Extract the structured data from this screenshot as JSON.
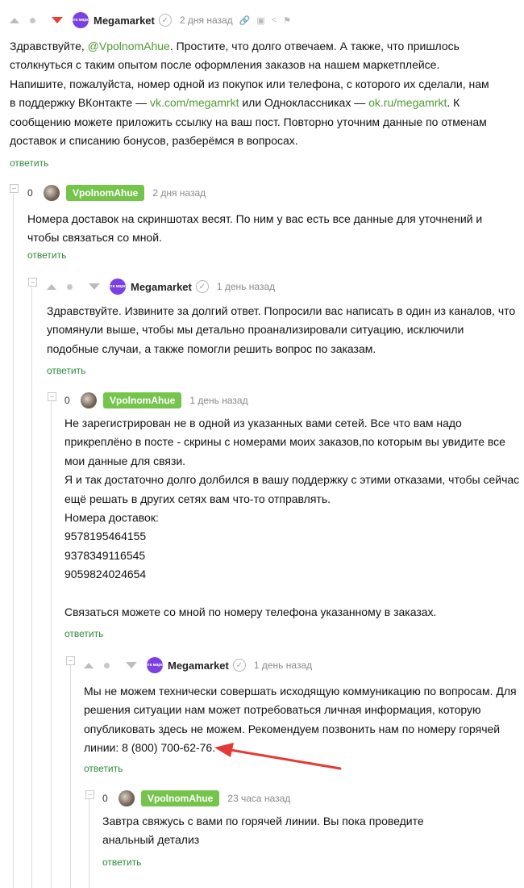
{
  "c1": {
    "author": "Megamarket",
    "avatar_text": "мега маркет",
    "time": "2 дня назад",
    "text_a": "Здравствуйте, ",
    "mention": "@VpolnomAhue",
    "text_b": ". Простите, что долго отвечаем. А также, что пришлось столкнуться с таким опытом после оформления заказов на нашем маркетплейсе. Напишите, пожалуйста, номер одной из покупок или телефона, с которого их сделали, нам в поддержку ВКонтакте — ",
    "link_vk": "vk.com/megamrkt",
    "text_c": " или Одноклассниках — ",
    "link_ok": "ok.ru/megamrkt",
    "text_d": ". К сообщению можете приложить ссылку на ваш пост. Повторно уточним данные по отменам доставок и списанию бонусов, разберёмся в вопросах.",
    "reply": "ответить"
  },
  "c2": {
    "score": "0",
    "author": "VpolnomAhue",
    "time": "2 дня назад",
    "text": "Номера доставок на скриншотах весят. По ним у вас есть все данные для уточнений и чтобы связаться со мной.",
    "reply": "ответить"
  },
  "c3": {
    "author": "Megamarket",
    "avatar_text": "мега маркет",
    "time": "1 день назад",
    "text": "Здравствуйте. Извините за долгий ответ. Попросили вас написать в один из каналов, что упомянули выше, чтобы мы детально проанализировали ситуацию, исключили подобные случаи, а также помогли решить вопрос по заказам.",
    "reply": "ответить"
  },
  "c4": {
    "score": "0",
    "author": "VpolnomAhue",
    "time": "1 день назад",
    "p1": "Не зарегистрирован не в одной из указанных вами сетей. Все что вам надо прикреплёно в посте - скрины с номерами моих заказов,по которым вы увидите все мои данные для связи.",
    "p2": "Я и так достаточно долго долбился в вашу поддержку с этими отказами, чтобы сейчас ещё решать в других сетях вам что-то отправлять.",
    "p3": "Номера доставок:",
    "n1": "9578195464155",
    "n2": "9378349116545",
    "n3": "9059824024654",
    "p4": "Связаться можете со мной по номеру телефона указанному в заказах.",
    "reply": "ответить"
  },
  "c5": {
    "author": "Megamarket",
    "avatar_text": "мега маркет",
    "time": "1 день назад",
    "text": "Мы не можем технически совершать исходящую коммуникацию по вопросам. Для решения ситуации нам может потребоваться личная информация, которую опубликовать здесь не можем. Рекомендуем позвонить нам по номеру горячей линии: 8 (800) 700-62-76.",
    "reply": "ответить"
  },
  "c6": {
    "score": "0",
    "author": "VpolnomAhue",
    "time": "23 часа назад",
    "line1": "Завтра свяжусь с вами по горячей линии. Вы пока проведите",
    "line2": "анальный детализ",
    "reply": "ответить"
  },
  "colors": {
    "accent_green": "#75c54c",
    "link_green": "#4e9a31",
    "downvote_red": "#e9402f",
    "annotation_arrow": "#e53935"
  }
}
